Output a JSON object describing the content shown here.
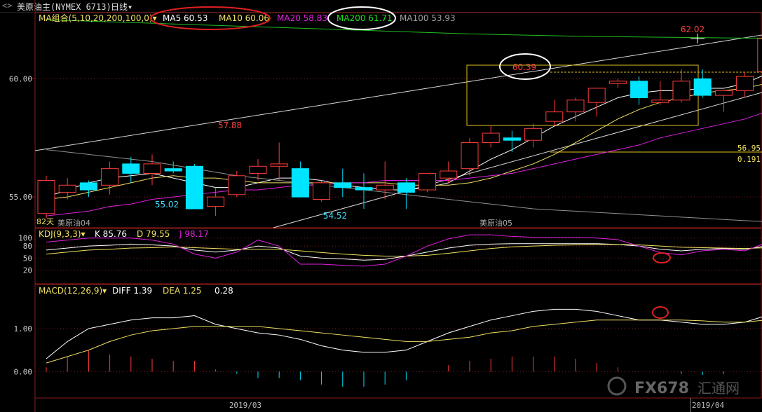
{
  "window": {
    "symbol_title": "美原油主(NYMEX 6713)",
    "period": "日线",
    "period_arrow": "▾",
    "nav_icon": "double-arrow-icon"
  },
  "main": {
    "indicator_label": "MA组合(5,10,20,200,100,0)",
    "indicator_arrow": "▾",
    "ma_readouts": [
      {
        "label": "MA5 60.53",
        "color": "#ffffff"
      },
      {
        "label": "MA10 60.06",
        "color": "#f0e060"
      },
      {
        "label": "MA20 58.83",
        "color": "#e020e0"
      },
      {
        "label": "MA200 61.71",
        "color": "#20e020"
      },
      {
        "label": "MA100 53.93",
        "color": "#a0a0a0"
      }
    ],
    "price_labels": [
      "60.00",
      "55.00"
    ],
    "annotations": {
      "high": "62.02",
      "peak": "60.39",
      "swing_high": "57.88",
      "swing_low1": "55.02",
      "swing_low2": "54.52"
    },
    "right_box": {
      "value1": "56.95",
      "value2": "0.191"
    },
    "contract_labels": [
      "82天",
      "美原油04",
      "美原油05"
    ]
  },
  "kdj": {
    "label": "KDJ(9,3,3)",
    "arrow": "▾",
    "readouts": [
      {
        "label": "K 85.76",
        "color": "#ffffff"
      },
      {
        "label": "D 79.55",
        "color": "#f0e060"
      },
      {
        "label": "J 98.17",
        "color": "#e020e0"
      }
    ],
    "levels": [
      "100",
      "80",
      "50",
      "20"
    ]
  },
  "macd": {
    "label": "MACD(12,26,9)",
    "arrow": "▾",
    "readouts": [
      {
        "label": "DIFF 1.39",
        "color": "#ffffff"
      },
      {
        "label": "DEA 1.25",
        "color": "#f0e060"
      },
      {
        "label": "0.28",
        "color": "#ffffff"
      }
    ],
    "levels": [
      "1.00",
      "0.00"
    ]
  },
  "xaxis": {
    "labels": [
      "2019/03",
      "2019/04"
    ]
  },
  "watermark": {
    "text": "FX678",
    "subtext": "汇通网"
  },
  "chart_data": {
    "type": "candlestick",
    "title": "美原油主(NYMEX 6713) 日线",
    "ylim": [
      54.0,
      62.5
    ],
    "candles": [
      {
        "o": 54.3,
        "h": 55.9,
        "l": 54.1,
        "c": 55.7
      },
      {
        "o": 55.2,
        "h": 55.8,
        "l": 54.9,
        "c": 55.5
      },
      {
        "o": 55.6,
        "h": 55.7,
        "l": 55.0,
        "c": 55.3
      },
      {
        "o": 55.5,
        "h": 56.5,
        "l": 55.1,
        "c": 56.2
      },
      {
        "o": 56.4,
        "h": 56.7,
        "l": 55.6,
        "c": 56.0
      },
      {
        "o": 56.0,
        "h": 56.8,
        "l": 55.5,
        "c": 56.4
      },
      {
        "o": 56.2,
        "h": 56.5,
        "l": 56.0,
        "c": 56.1
      },
      {
        "o": 56.3,
        "h": 56.4,
        "l": 54.5,
        "c": 54.5
      },
      {
        "o": 54.6,
        "h": 55.4,
        "l": 54.2,
        "c": 55.0
      },
      {
        "o": 55.1,
        "h": 56.1,
        "l": 55.0,
        "c": 55.9
      },
      {
        "o": 56.0,
        "h": 56.6,
        "l": 55.7,
        "c": 56.3
      },
      {
        "o": 56.3,
        "h": 57.3,
        "l": 55.7,
        "c": 56.4
      },
      {
        "o": 56.2,
        "h": 56.5,
        "l": 55.0,
        "c": 55.0
      },
      {
        "o": 54.9,
        "h": 55.7,
        "l": 54.8,
        "c": 55.6
      },
      {
        "o": 55.6,
        "h": 56.2,
        "l": 55.0,
        "c": 55.4
      },
      {
        "o": 55.4,
        "h": 56.0,
        "l": 54.5,
        "c": 55.3
      },
      {
        "o": 55.3,
        "h": 56.5,
        "l": 54.9,
        "c": 55.5
      },
      {
        "o": 55.6,
        "h": 55.8,
        "l": 54.5,
        "c": 55.2
      },
      {
        "o": 55.3,
        "h": 56.0,
        "l": 55.2,
        "c": 56.0
      },
      {
        "o": 55.8,
        "h": 56.5,
        "l": 55.6,
        "c": 56.1
      },
      {
        "o": 56.2,
        "h": 57.5,
        "l": 55.9,
        "c": 57.3
      },
      {
        "o": 57.3,
        "h": 58.0,
        "l": 57.1,
        "c": 57.7
      },
      {
        "o": 57.5,
        "h": 57.8,
        "l": 56.9,
        "c": 57.4
      },
      {
        "o": 57.4,
        "h": 58.1,
        "l": 57.1,
        "c": 57.9
      },
      {
        "o": 58.2,
        "h": 59.1,
        "l": 58.0,
        "c": 58.6
      },
      {
        "o": 58.6,
        "h": 59.2,
        "l": 58.2,
        "c": 59.1
      },
      {
        "o": 59.0,
        "h": 59.4,
        "l": 58.4,
        "c": 59.6
      },
      {
        "o": 59.8,
        "h": 60.0,
        "l": 59.6,
        "c": 59.9
      },
      {
        "o": 59.9,
        "h": 60.1,
        "l": 58.9,
        "c": 59.2
      },
      {
        "o": 59.0,
        "h": 59.9,
        "l": 58.9,
        "c": 59.1
      },
      {
        "o": 59.1,
        "h": 60.4,
        "l": 59.0,
        "c": 59.9
      },
      {
        "o": 60.0,
        "h": 60.4,
        "l": 59.2,
        "c": 59.3
      },
      {
        "o": 59.3,
        "h": 59.5,
        "l": 58.6,
        "c": 59.5
      },
      {
        "o": 59.5,
        "h": 60.3,
        "l": 59.2,
        "c": 60.1
      },
      {
        "o": 60.3,
        "h": 60.7,
        "l": 59.1,
        "c": 61.7
      },
      {
        "o": 61.7,
        "h": 62.02,
        "l": 61.5,
        "c": 61.8
      }
    ],
    "ma": {
      "MA5": [
        55.0,
        55.3,
        55.6,
        55.8,
        55.9,
        56.0,
        55.8,
        55.6,
        55.4,
        55.4,
        55.6,
        55.8,
        55.8,
        55.7,
        55.5,
        55.4,
        55.3,
        55.3,
        55.4,
        55.6,
        56.1,
        56.6,
        57.0,
        57.5,
        58.0,
        58.4,
        58.8,
        59.2,
        59.4,
        59.5,
        59.5,
        59.6,
        59.6,
        59.8,
        60.2,
        60.53
      ],
      "MA10": [
        54.9,
        55.0,
        55.2,
        55.4,
        55.6,
        55.8,
        55.9,
        55.8,
        55.8,
        55.7,
        55.6,
        55.6,
        55.6,
        55.6,
        55.6,
        55.6,
        55.6,
        55.5,
        55.5,
        55.5,
        55.6,
        55.8,
        56.1,
        56.4,
        56.8,
        57.3,
        57.8,
        58.3,
        58.7,
        59.0,
        59.2,
        59.4,
        59.5,
        59.6,
        59.8,
        60.06
      ],
      "MA20": [
        54.2,
        54.3,
        54.4,
        54.6,
        54.7,
        54.9,
        55.0,
        55.1,
        55.2,
        55.3,
        55.3,
        55.4,
        55.5,
        55.5,
        55.6,
        55.6,
        55.7,
        55.7,
        55.7,
        55.7,
        55.8,
        55.9,
        56.0,
        56.2,
        56.4,
        56.6,
        56.8,
        57.0,
        57.2,
        57.5,
        57.7,
        57.9,
        58.1,
        58.3,
        58.6,
        58.83
      ],
      "MA200": [
        62.5,
        62.47,
        62.44,
        62.41,
        62.38,
        62.35,
        62.32,
        62.29,
        62.26,
        62.23,
        62.2,
        62.17,
        62.14,
        62.11,
        62.08,
        62.05,
        62.02,
        61.99,
        61.96,
        61.93,
        61.9,
        61.88,
        61.86,
        61.84,
        61.82,
        61.8,
        61.79,
        61.78,
        61.77,
        61.76,
        61.75,
        61.74,
        61.73,
        61.72,
        61.72,
        61.71
      ],
      "MA100": [
        57.0,
        56.9,
        56.8,
        56.7,
        56.6,
        56.5,
        56.35,
        56.2,
        56.05,
        55.9,
        55.8,
        55.7,
        55.6,
        55.5,
        55.4,
        55.3,
        55.2,
        55.1,
        55.0,
        54.9,
        54.8,
        54.7,
        54.6,
        54.5,
        54.45,
        54.4,
        54.35,
        54.3,
        54.25,
        54.2,
        54.15,
        54.1,
        54.05,
        54.0,
        53.96,
        53.93
      ]
    },
    "kdj_series": {
      "K": [
        70,
        75,
        80,
        82,
        85,
        83,
        80,
        70,
        65,
        70,
        80,
        75,
        55,
        50,
        48,
        45,
        47,
        55,
        65,
        75,
        82,
        85,
        86,
        86,
        86,
        86,
        86,
        84,
        80,
        72,
        68,
        72,
        74,
        72,
        80,
        85.76
      ],
      "D": [
        60,
        65,
        70,
        72,
        75,
        76,
        78,
        76,
        74,
        72,
        72,
        72,
        68,
        64,
        60,
        57,
        55,
        55,
        57,
        62,
        68,
        74,
        78,
        80,
        82,
        83,
        84,
        84,
        83,
        80,
        77,
        76,
        75,
        74,
        76,
        79.55
      ],
      "J": [
        90,
        95,
        100,
        100,
        100,
        95,
        85,
        60,
        50,
        65,
        95,
        80,
        35,
        35,
        32,
        30,
        35,
        55,
        80,
        98,
        108,
        108,
        104,
        102,
        102,
        102,
        100,
        96,
        80,
        64,
        58,
        68,
        72,
        68,
        88,
        98.17
      ]
    },
    "macd_series": {
      "DIFF": [
        0.3,
        0.7,
        1.0,
        1.1,
        1.2,
        1.25,
        1.25,
        1.3,
        1.1,
        1.0,
        0.9,
        0.85,
        0.75,
        0.6,
        0.5,
        0.45,
        0.45,
        0.5,
        0.7,
        0.9,
        1.05,
        1.2,
        1.3,
        1.4,
        1.45,
        1.45,
        1.4,
        1.3,
        1.2,
        1.2,
        1.15,
        1.1,
        1.1,
        1.15,
        1.3,
        1.39
      ],
      "DEA": [
        0.2,
        0.35,
        0.5,
        0.7,
        0.85,
        0.95,
        1.0,
        1.05,
        1.05,
        1.05,
        1.05,
        1.0,
        0.95,
        0.9,
        0.85,
        0.8,
        0.75,
        0.7,
        0.7,
        0.75,
        0.8,
        0.9,
        0.95,
        1.05,
        1.1,
        1.15,
        1.2,
        1.2,
        1.2,
        1.2,
        1.2,
        1.18,
        1.15,
        1.15,
        1.2,
        1.25
      ],
      "MACD": [
        0.1,
        0.35,
        0.5,
        0.4,
        0.35,
        0.3,
        0.25,
        0.25,
        0.05,
        -0.05,
        -0.15,
        -0.15,
        -0.2,
        -0.3,
        -0.35,
        -0.35,
        -0.3,
        -0.2,
        0.0,
        0.15,
        0.25,
        0.3,
        0.35,
        0.35,
        0.35,
        0.3,
        0.2,
        0.1,
        0.0,
        0.0,
        -0.05,
        -0.08,
        -0.05,
        0.0,
        0.1,
        0.28
      ]
    }
  }
}
